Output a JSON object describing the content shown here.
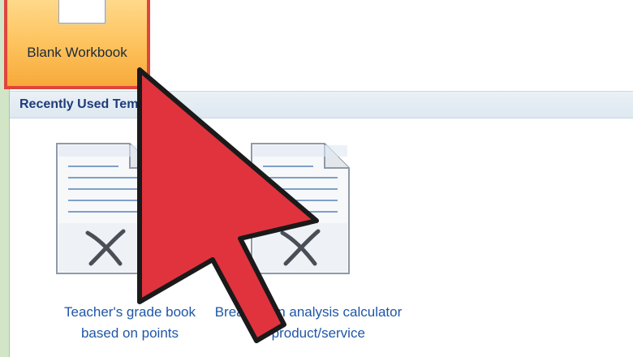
{
  "blank_workbook": {
    "label": "Blank Workbook"
  },
  "recent_templates": {
    "title": "Recently Used Templates",
    "items": [
      {
        "line1": "Teacher's grade book",
        "line2": "based on points",
        "icon": "excel-template-icon"
      },
      {
        "line1": "Break-even analysis calculator",
        "line2": "for product/service",
        "icon": "excel-template-icon"
      }
    ]
  },
  "overlay": {
    "icon": "mouse-pointer-arrow-icon",
    "color": "#e1333d"
  },
  "colors": {
    "selection_border": "#e0453c",
    "tile_fill": "#fdc15a",
    "section_title": "#1f3b7a",
    "template_link": "#1f56a8"
  }
}
